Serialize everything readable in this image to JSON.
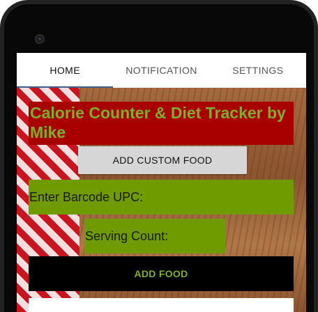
{
  "tabs": [
    {
      "label": "HOME"
    },
    {
      "label": "NOTIFICATION"
    },
    {
      "label": "SETTINGS"
    }
  ],
  "home": {
    "title": "Calorie Counter & Diet Tracker by Mike",
    "add_custom_food_label": "ADD CUSTOM FOOD",
    "barcode_placeholder": "Enter Barcode UPC:",
    "serving_placeholder": "Serving Count:",
    "add_food_label": "ADD FOOD"
  },
  "colors": {
    "title_bg": "#a80000",
    "title_text": "#7fae2a",
    "input_bg": "#6f9a00",
    "add_food_bg": "#000000",
    "tab_indicator": "#3f5f8a"
  }
}
